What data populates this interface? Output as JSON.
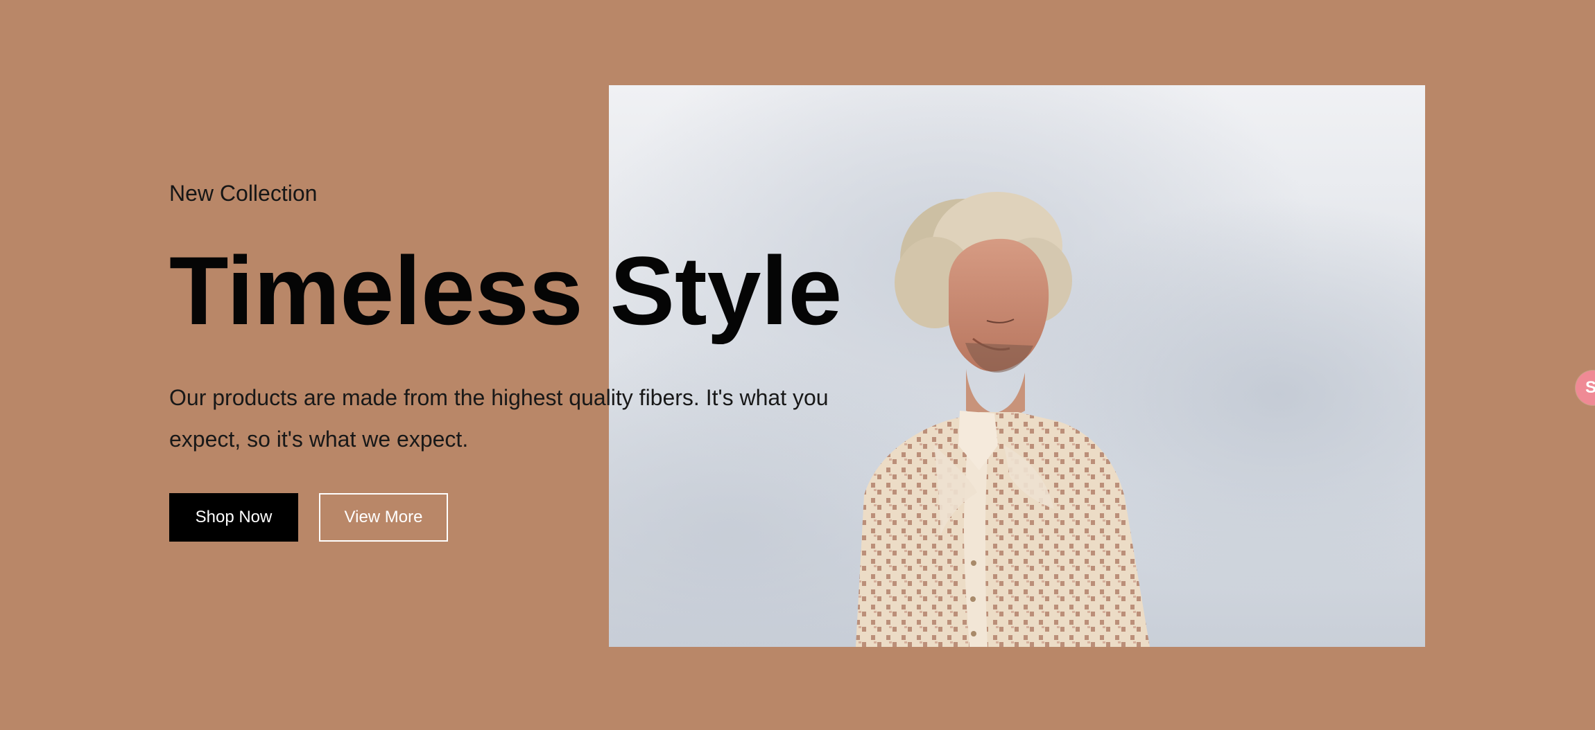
{
  "hero": {
    "eyebrow": "New Collection",
    "headline": "Timeless Style",
    "subcopy": "Our products are made from the highest quality fibers. It's what you expect, so it's what we expect.",
    "buttons": {
      "primary": "Shop Now",
      "secondary": "View More"
    },
    "colors": {
      "background": "#b98768",
      "headline": "#050505",
      "primary_button": "#000000",
      "secondary_button_border": "#ffffff",
      "side_badge": "#ef8a95"
    }
  },
  "side_badge": {
    "label": "S"
  }
}
